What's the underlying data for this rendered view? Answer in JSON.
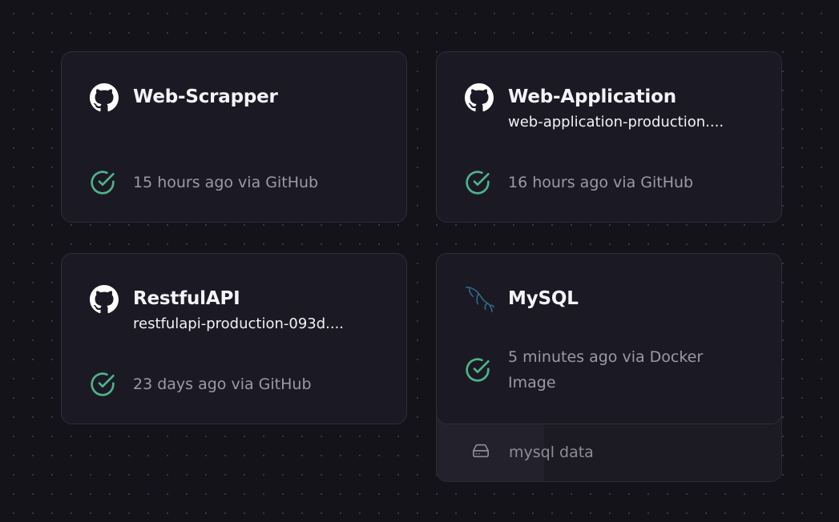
{
  "cards": [
    {
      "name": "Web-Scrapper",
      "url": "",
      "icon": "github-icon",
      "status": "15 hours ago via GitHub"
    },
    {
      "name": "Web-Application",
      "url": "web-application-production....",
      "icon": "github-icon",
      "status": "16 hours ago via GitHub"
    },
    {
      "name": "RestfulAPI",
      "url": "restfulapi-production-093d....",
      "icon": "github-icon",
      "status": "23 days ago via GitHub"
    },
    {
      "name": "MySQL",
      "url": "",
      "icon": "mysql-dolphin-icon",
      "status_line1": "5 minutes ago via Docker",
      "status_line2": "Image"
    }
  ],
  "volume": {
    "label": "mysql data",
    "icon": "hard-drive-icon"
  },
  "colors": {
    "background": "#14131a",
    "card": "#1b1a24",
    "success": "#4fb38a",
    "mysql": "#2f6e93"
  }
}
